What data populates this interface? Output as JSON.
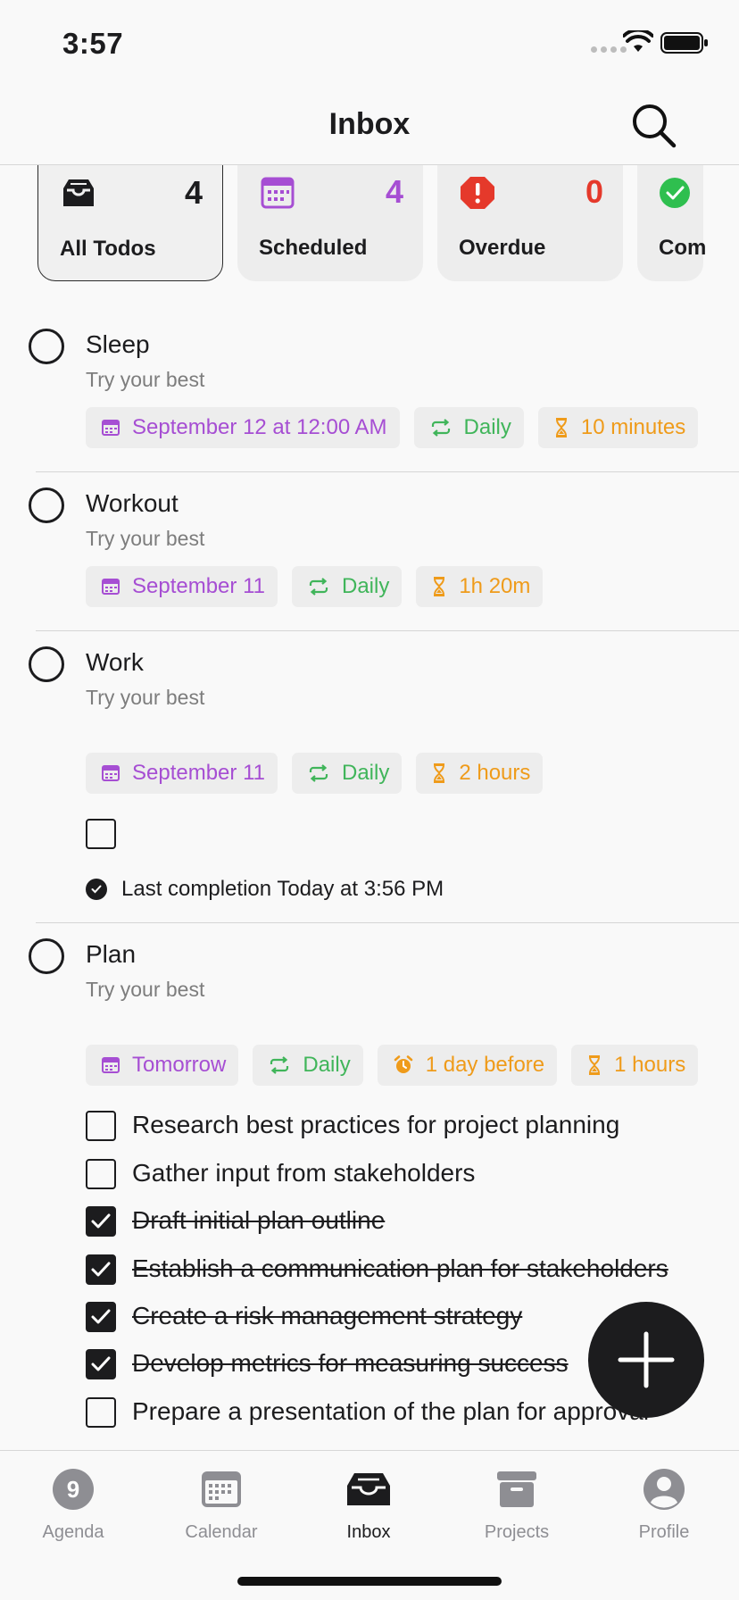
{
  "status_bar": {
    "time": "3:57"
  },
  "header": {
    "title": "Inbox",
    "search_icon": "search-icon"
  },
  "filters": [
    {
      "label": "All Todos",
      "count": "4",
      "icon": "tray-icon",
      "color": "#1c1c1e"
    },
    {
      "label": "Scheduled",
      "count": "4",
      "icon": "calendar-icon",
      "color": "#a64ed3"
    },
    {
      "label": "Overdue",
      "count": "0",
      "icon": "alert-icon",
      "color": "#e5392b"
    },
    {
      "label": "Com",
      "count": "",
      "icon": "check-circle-icon",
      "color": "#2fbf4f"
    }
  ],
  "todos": [
    {
      "name": "Sleep",
      "note": "Try your best",
      "chips": [
        "September 12 at 12:00 AM",
        "Daily",
        "10 minutes"
      ]
    },
    {
      "name": "Workout",
      "note": "Try your best",
      "chips": [
        "September 11",
        "Daily",
        "1h 20m"
      ]
    },
    {
      "name": "Work",
      "note": "Try your best",
      "chips": [
        "September 11",
        "Daily",
        "2 hours"
      ],
      "last_completion": "Last completion Today at 3:56 PM"
    },
    {
      "name": "Plan",
      "note": "Try your best",
      "chips": [
        "Tomorrow",
        "Daily",
        "1 day before",
        "1 hours"
      ],
      "subtasks": [
        {
          "text": "Research best practices for project planning",
          "done": false
        },
        {
          "text": "Gather input from stakeholders",
          "done": false
        },
        {
          "text": "Draft initial plan outline",
          "done": true
        },
        {
          "text": "Establish a communication plan for stakeholders",
          "done": true
        },
        {
          "text": "Create a risk management strategy",
          "done": true
        },
        {
          "text": "Develop metrics for measuring success",
          "done": true
        },
        {
          "text": "Prepare a presentation of the plan for approval",
          "done": false
        }
      ]
    }
  ],
  "fab": {
    "icon": "plus-icon"
  },
  "tabbar": [
    {
      "label": "Agenda",
      "badge": "9",
      "icon": "agenda-icon"
    },
    {
      "label": "Calendar",
      "icon": "calendar-icon"
    },
    {
      "label": "Inbox",
      "icon": "tray-icon",
      "active": true
    },
    {
      "label": "Projects",
      "icon": "archive-box-icon"
    },
    {
      "label": "Profile",
      "icon": "person-icon"
    }
  ],
  "colors": {
    "purple": "#a64ed3",
    "green": "#40b55a",
    "orange": "#ef9b1a",
    "red": "#e5392b",
    "text": "#1c1c1e"
  }
}
